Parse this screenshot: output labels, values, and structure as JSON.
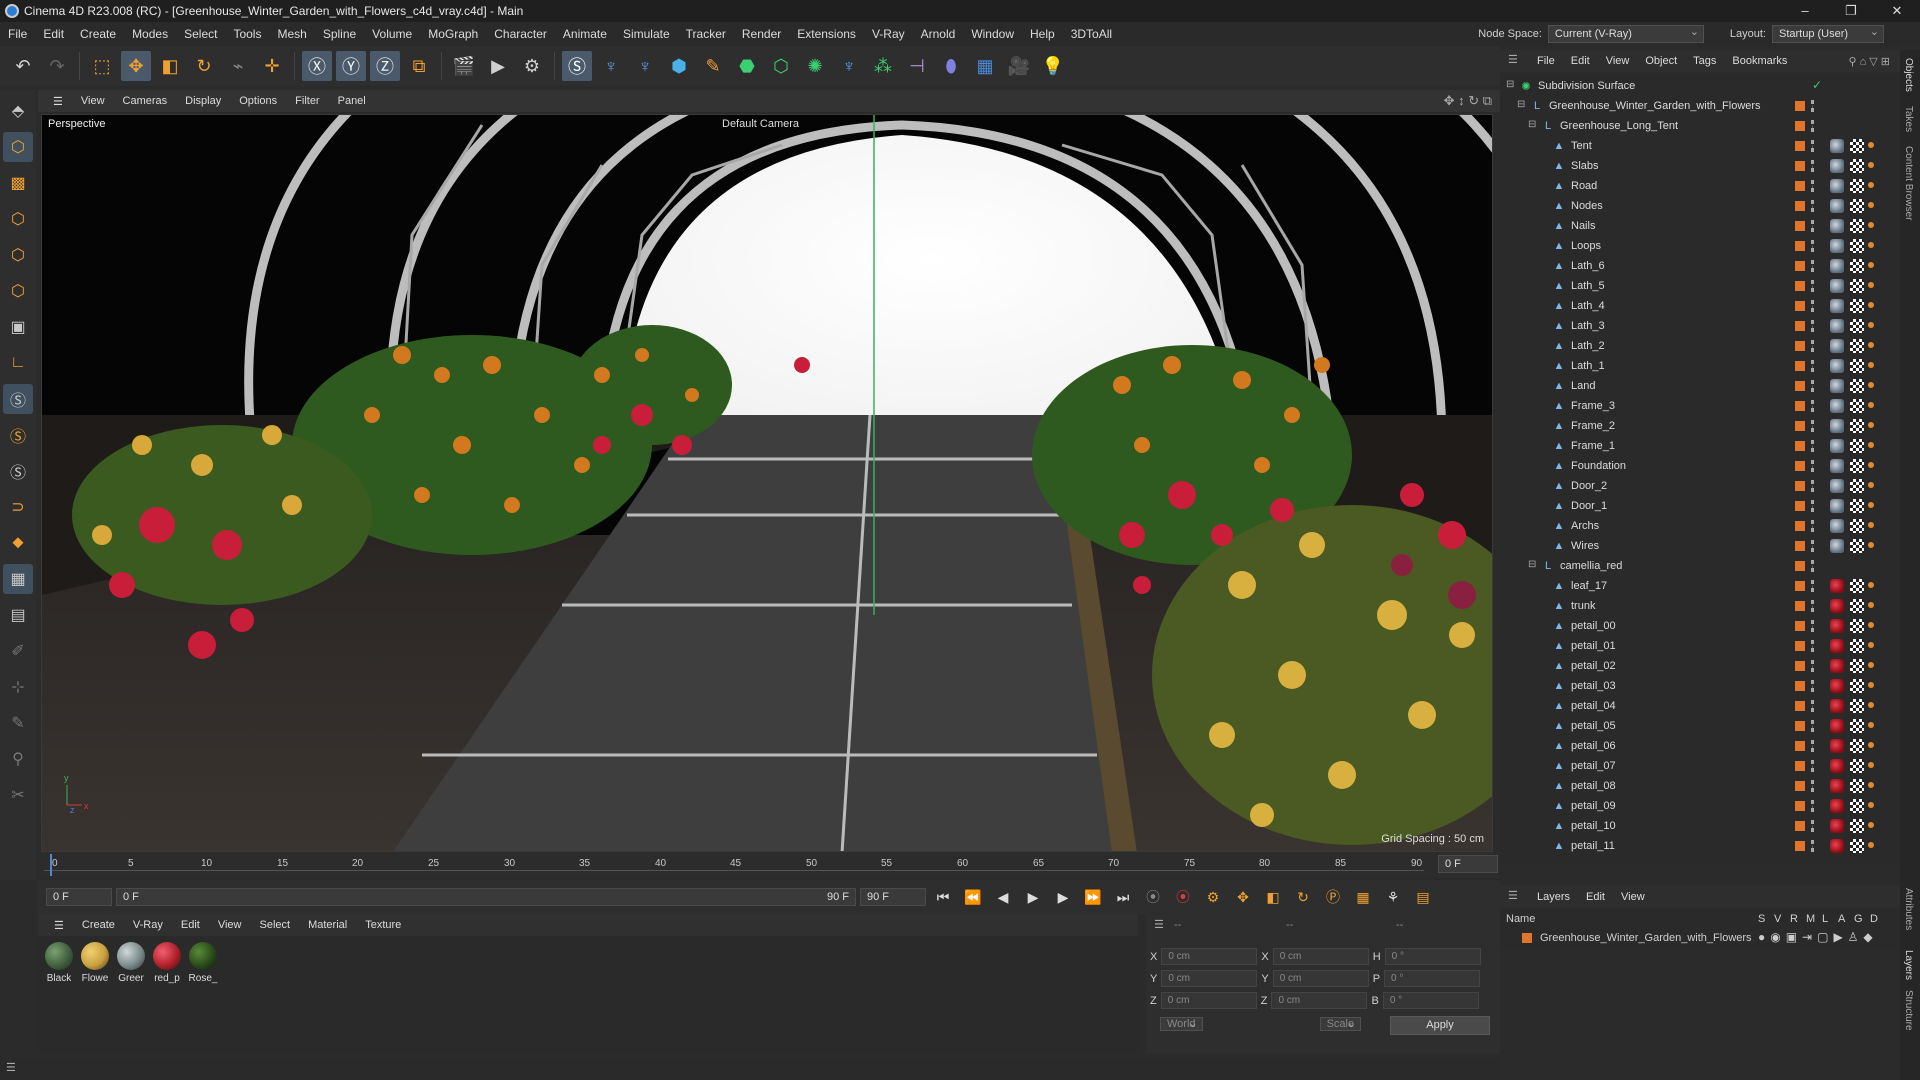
{
  "window": {
    "title": "Cinema 4D R23.008 (RC) - [Greenhouse_Winter_Garden_with_Flowers_c4d_vray.c4d] - Main",
    "controls": [
      "–",
      "❐",
      "✕"
    ]
  },
  "menubar": {
    "items": [
      "File",
      "Edit",
      "Create",
      "Modes",
      "Select",
      "Tools",
      "Mesh",
      "Spline",
      "Volume",
      "MoGraph",
      "Character",
      "Animate",
      "Simulate",
      "Tracker",
      "Render",
      "Extensions",
      "V-Ray",
      "Arnold",
      "Window",
      "Help",
      "3DToAll"
    ],
    "node_space_label": "Node Space:",
    "node_space_value": "Current (V-Ray)",
    "layout_label": "Layout:",
    "layout_value": "Startup (User)"
  },
  "viewport": {
    "menu": [
      "View",
      "Cameras",
      "Display",
      "Options",
      "Filter",
      "Panel"
    ],
    "label": "Perspective",
    "camera": "Default Camera",
    "grid_spacing": "Grid Spacing : 50 cm"
  },
  "timeline": {
    "ticks": [
      "0",
      "5",
      "10",
      "15",
      "20",
      "25",
      "30",
      "35",
      "40",
      "45",
      "50",
      "55",
      "60",
      "65",
      "70",
      "75",
      "80",
      "85",
      "90"
    ],
    "current_frame": "0 F",
    "start": "0 F",
    "range_start": "0 F",
    "range_end": "90 F",
    "end": "90 F"
  },
  "material_manager": {
    "menu": [
      "Create",
      "V-Ray",
      "Edit",
      "View",
      "Select",
      "Material",
      "Texture"
    ],
    "materials": [
      {
        "label": "Black",
        "color": "#3d5a3a"
      },
      {
        "label": "Flowe",
        "color": "#c8a040"
      },
      {
        "label": "Greer",
        "color": "#7a8a8a"
      },
      {
        "label": "red_p",
        "color": "#b0202a"
      },
      {
        "label": "Rose_",
        "color": "#2a4a1a"
      }
    ]
  },
  "coords": {
    "header": "--",
    "rows": [
      {
        "a": "X",
        "av": "0 cm",
        "b": "X",
        "bv": "0 cm",
        "c": "H",
        "cv": "0 °"
      },
      {
        "a": "Y",
        "av": "0 cm",
        "b": "Y",
        "bv": "0 cm",
        "c": "P",
        "cv": "0 °"
      },
      {
        "a": "Z",
        "av": "0 cm",
        "b": "Z",
        "bv": "0 cm",
        "c": "B",
        "cv": "0 °"
      }
    ],
    "space": "World",
    "mode": "Scale",
    "apply": "Apply"
  },
  "object_manager": {
    "menu": [
      "File",
      "Edit",
      "View",
      "Object",
      "Tags",
      "Bookmarks"
    ],
    "objects": [
      {
        "name": "Subdivision Surface",
        "indent": 0,
        "icon": "subdivision-icon",
        "kind": "generator"
      },
      {
        "name": "Greenhouse_Winter_Garden_with_Flowers",
        "indent": 1,
        "icon": "null-icon",
        "kind": "null"
      },
      {
        "name": "Greenhouse_Long_Tent",
        "indent": 2,
        "icon": "null-icon",
        "kind": "null"
      },
      {
        "name": "Tent",
        "indent": 3,
        "icon": "polygon-icon",
        "kind": "grey"
      },
      {
        "name": "Slabs",
        "indent": 3,
        "icon": "polygon-icon",
        "kind": "grey"
      },
      {
        "name": "Road",
        "indent": 3,
        "icon": "polygon-icon",
        "kind": "grey"
      },
      {
        "name": "Nodes",
        "indent": 3,
        "icon": "polygon-icon",
        "kind": "grey"
      },
      {
        "name": "Nails",
        "indent": 3,
        "icon": "polygon-icon",
        "kind": "grey"
      },
      {
        "name": "Loops",
        "indent": 3,
        "icon": "polygon-icon",
        "kind": "grey"
      },
      {
        "name": "Lath_6",
        "indent": 3,
        "icon": "polygon-icon",
        "kind": "grey"
      },
      {
        "name": "Lath_5",
        "indent": 3,
        "icon": "polygon-icon",
        "kind": "grey"
      },
      {
        "name": "Lath_4",
        "indent": 3,
        "icon": "polygon-icon",
        "kind": "grey"
      },
      {
        "name": "Lath_3",
        "indent": 3,
        "icon": "polygon-icon",
        "kind": "grey"
      },
      {
        "name": "Lath_2",
        "indent": 3,
        "icon": "polygon-icon",
        "kind": "grey"
      },
      {
        "name": "Lath_1",
        "indent": 3,
        "icon": "polygon-icon",
        "kind": "grey"
      },
      {
        "name": "Land",
        "indent": 3,
        "icon": "polygon-icon",
        "kind": "grey"
      },
      {
        "name": "Frame_3",
        "indent": 3,
        "icon": "polygon-icon",
        "kind": "grey"
      },
      {
        "name": "Frame_2",
        "indent": 3,
        "icon": "polygon-icon",
        "kind": "grey"
      },
      {
        "name": "Frame_1",
        "indent": 3,
        "icon": "polygon-icon",
        "kind": "grey"
      },
      {
        "name": "Foundation",
        "indent": 3,
        "icon": "polygon-icon",
        "kind": "grey"
      },
      {
        "name": "Door_2",
        "indent": 3,
        "icon": "polygon-icon",
        "kind": "grey"
      },
      {
        "name": "Door_1",
        "indent": 3,
        "icon": "polygon-icon",
        "kind": "grey"
      },
      {
        "name": "Archs",
        "indent": 3,
        "icon": "polygon-icon",
        "kind": "grey"
      },
      {
        "name": "Wires",
        "indent": 3,
        "icon": "polygon-icon",
        "kind": "grey"
      },
      {
        "name": "camellia_red",
        "indent": 2,
        "icon": "null-icon",
        "kind": "null"
      },
      {
        "name": "leaf_17",
        "indent": 3,
        "icon": "polygon-icon",
        "kind": "red"
      },
      {
        "name": "trunk",
        "indent": 3,
        "icon": "polygon-icon",
        "kind": "red"
      },
      {
        "name": "petail_00",
        "indent": 3,
        "icon": "polygon-icon",
        "kind": "red"
      },
      {
        "name": "petail_01",
        "indent": 3,
        "icon": "polygon-icon",
        "kind": "red"
      },
      {
        "name": "petail_02",
        "indent": 3,
        "icon": "polygon-icon",
        "kind": "red"
      },
      {
        "name": "petail_03",
        "indent": 3,
        "icon": "polygon-icon",
        "kind": "red"
      },
      {
        "name": "petail_04",
        "indent": 3,
        "icon": "polygon-icon",
        "kind": "red"
      },
      {
        "name": "petail_05",
        "indent": 3,
        "icon": "polygon-icon",
        "kind": "red"
      },
      {
        "name": "petail_06",
        "indent": 3,
        "icon": "polygon-icon",
        "kind": "red"
      },
      {
        "name": "petail_07",
        "indent": 3,
        "icon": "polygon-icon",
        "kind": "red"
      },
      {
        "name": "petail_08",
        "indent": 3,
        "icon": "polygon-icon",
        "kind": "red"
      },
      {
        "name": "petail_09",
        "indent": 3,
        "icon": "polygon-icon",
        "kind": "red"
      },
      {
        "name": "petail_10",
        "indent": 3,
        "icon": "polygon-icon",
        "kind": "red"
      },
      {
        "name": "petail_11",
        "indent": 3,
        "icon": "polygon-icon",
        "kind": "red"
      }
    ]
  },
  "layers": {
    "menu": [
      "Layers",
      "Edit",
      "View"
    ],
    "columns": [
      "Name",
      "S",
      "V",
      "R",
      "M",
      "L",
      "A",
      "G",
      "D"
    ],
    "rows": [
      {
        "name": "Greenhouse_Winter_Garden_with_Flowers",
        "color": "#e0762b"
      }
    ]
  },
  "side_tabs": [
    "Objects",
    "Takes",
    "Content Browser",
    "Attributes",
    "Layers",
    "Structure"
  ]
}
